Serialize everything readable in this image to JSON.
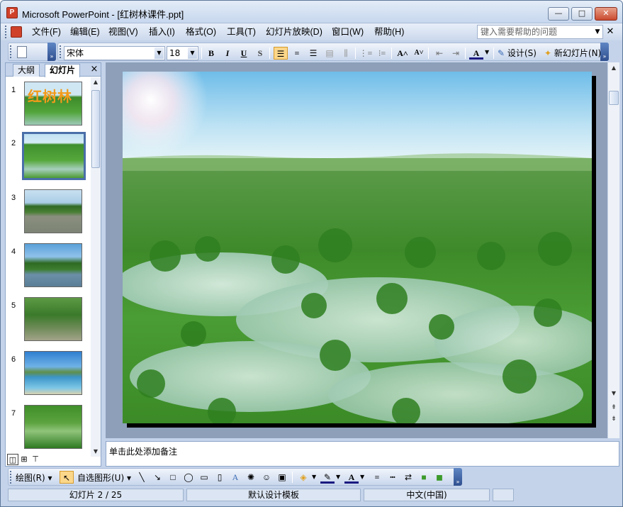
{
  "window": {
    "title": "Microsoft PowerPoint - [红树林课件.ppt]",
    "app_icon_letter": "P",
    "controls": {
      "minimize": "—",
      "maximize": "□",
      "close": "✕"
    }
  },
  "menubar": {
    "items": [
      "文件(F)",
      "编辑(E)",
      "视图(V)",
      "插入(I)",
      "格式(O)",
      "工具(T)",
      "幻灯片放映(D)",
      "窗口(W)",
      "帮助(H)"
    ],
    "help_placeholder": "键入需要帮助的问题"
  },
  "formatting": {
    "font_name": "宋体",
    "font_size": "18",
    "bold": "B",
    "italic": "I",
    "underline": "U",
    "shadow": "S",
    "design_label": "设计(S)",
    "new_slide_label": "新幻灯片(N)"
  },
  "left_pane": {
    "tabs": [
      "大纲",
      "幻灯片"
    ],
    "active_tab": "幻灯片",
    "close": "×",
    "slides": [
      {
        "num": "1",
        "text": "红树林",
        "icon": "mangrove-title-thumbnail"
      },
      {
        "num": "2",
        "text": "",
        "icon": "mangrove-forest-thumbnail"
      },
      {
        "num": "3",
        "text": "",
        "icon": "mangrove-shore-thumbnail"
      },
      {
        "num": "4",
        "text": "",
        "icon": "mangrove-river-thumbnail"
      },
      {
        "num": "5",
        "text": "",
        "icon": "mangrove-roots-thumbnail"
      },
      {
        "num": "6",
        "text": "",
        "icon": "mangrove-beach-thumbnail"
      },
      {
        "num": "7",
        "text": "",
        "icon": "mangrove-birds-thumbnail"
      }
    ],
    "selected_slide": "2"
  },
  "slide": {
    "image": "mangrove-forest-photo"
  },
  "notes": {
    "placeholder": "单击此处添加备注"
  },
  "drawing": {
    "draw_label": "绘图(R)",
    "autoshapes_label": "自选图形(U)"
  },
  "status": {
    "slide_counter": "幻灯片 2 / 25",
    "template": "默认设计模板",
    "language": "中文(中国)"
  },
  "colors": {
    "chrome": "#c4d3ea",
    "selection": "#4a6ea8",
    "accent": "#fbd78a"
  }
}
